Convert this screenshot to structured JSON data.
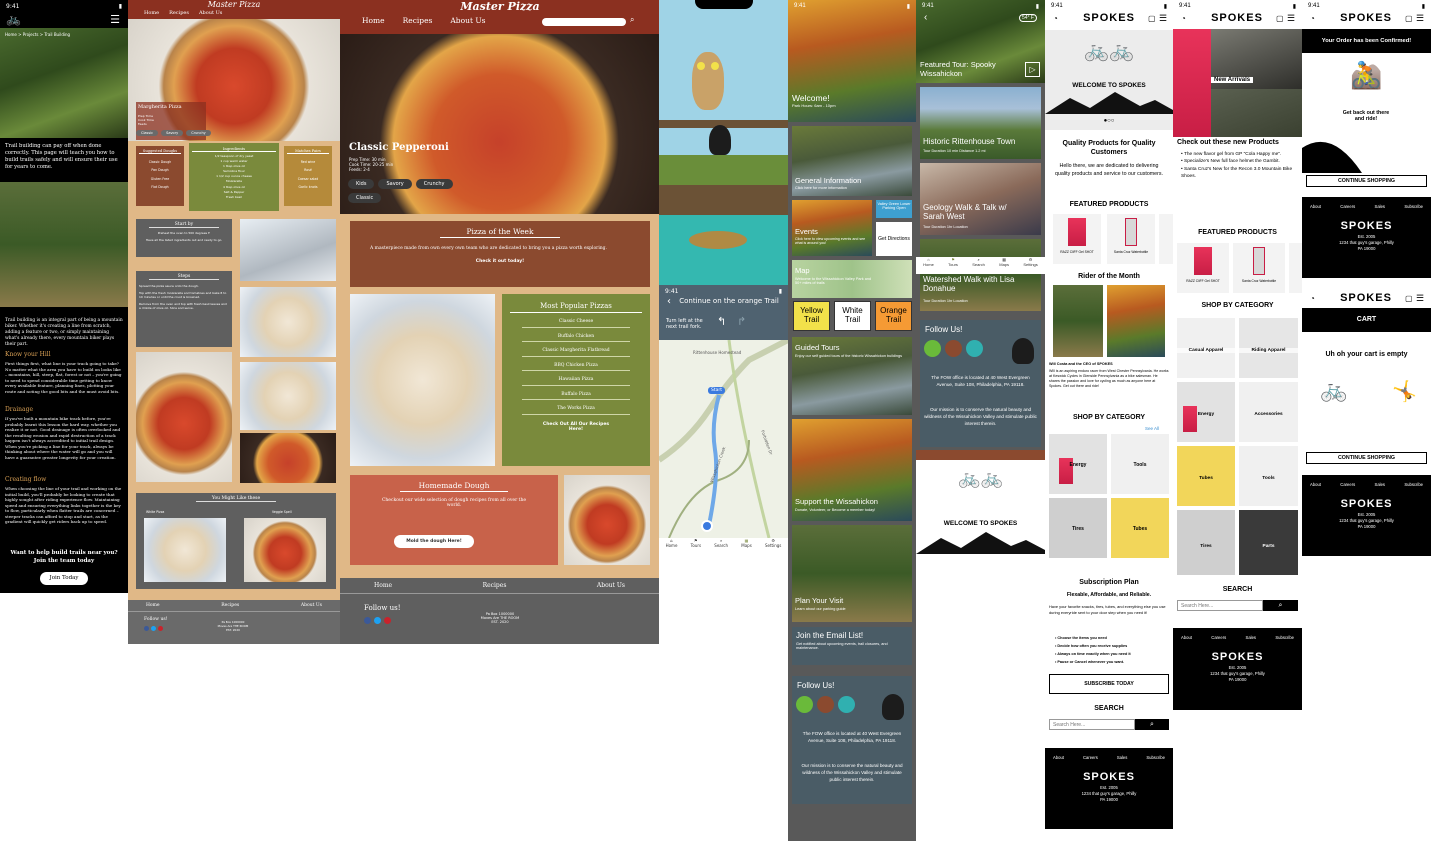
{
  "trail": {
    "status_time": "9:41",
    "breadcrumb": "Home > Projects > Trail Building",
    "p1": "Trail building can pay off when done correctly. This page will teach you how to build trails safely and will ensure their use for years to come.",
    "p2": "Trail building is an integral part of being a mountain biker. Whether it's creating a line from scratch, adding a feature or two, or simply maintaining what's already there, every mountain biker plays their part.",
    "h1": "Know your Hill",
    "p3": "First things first, what line is your track going to take? No matter what the area you have to build on looks like – mountains, hill, steep, flat, forest or not – you're going to need to spend considerable time getting to know every available feature, planning lines, plotting your route and noting the good bits and the must avoid bits.",
    "h2": "Drainage",
    "p4": "If you've built a mountain bike track before, you're probably learnt this lesson the hard way, whether you realize it or not. Good drainage is often overlooked and the resulting erosion and rapid destruction of a track happen isn't always accredited to initial trail design. When you're picking a line for your track, always be thinking about where the water will go and you will have a guarantee greater longevity for your creation.",
    "h3": "Creating flow",
    "p5": "When choosing the line of your trail and working on the initial build, you'll probably be looking to create that highly sought after riding experience flow. Maintaining speed and ensuring everything links together is the key to flow, particularly when flatter trails are concerned – steeper tracks can afford to stop and start, as the gradient will quickly get riders back up to speed.",
    "cta": "Want to help build trails near you? Join the team today",
    "btn": "Join Today"
  },
  "pizza_small": {
    "title": "Master Pizza",
    "nav": [
      "Home",
      "Recipes",
      "About Us"
    ],
    "hero": "Margherita Pizza",
    "hero_meta": "Prep Time\nCook Time\nFeeds",
    "tags": [
      "Classic",
      "Savory",
      "Crunchy"
    ],
    "cols": [
      {
        "title": "Suggested Doughs",
        "items": [
          "Classic Dough",
          "Pan Dough",
          "Gluten Free",
          "Flat Dough"
        ]
      },
      {
        "title": "Ingredients",
        "items": [
          "1/2 teaspoon of dry yeast",
          "1 cup warm water",
          "1 tbsp olive oil",
          "Semolina flour",
          "1 1/2 cup ounce cheese",
          "Mozzarella",
          "4 tbsp olive oil",
          "Salt & Pepper",
          "Fresh basil"
        ]
      },
      {
        "title": "Matches Pairs",
        "items": [
          "Red wine",
          "Rosé",
          "Caesar salad",
          "Garlic knots"
        ]
      }
    ],
    "start_title": "Start by",
    "start_body": "Preheat the oven to 500 degrees F.",
    "start_body2": "Have all the listed ingredients out and ready to go.",
    "steps_title": "Steps",
    "steps": [
      "Spread the pizza sauce onto the dough.",
      "Top with the fresh mozzarella and tomatoes and bake 8 to 10 minutes or until the crust is browned.",
      "Remove from the oven and top with fresh basil leaves and a drizzle of olive oil. Slice and serve."
    ],
    "also_title": "You Might Like these",
    "also": [
      "White Pizza",
      "Veggie Spell"
    ],
    "footer_nav": [
      "Home",
      "Recipes",
      "About Us"
    ],
    "follow": "Follow us!",
    "address": "Pa Box 1000000\nMoves Are THE ROOM\nEST. 2020"
  },
  "pizza_big": {
    "title": "Master Pizza",
    "nav": [
      "Home",
      "Recipes",
      "About Us"
    ],
    "hero": "Classic Pepperoni",
    "hero_meta": [
      "Prep Time: 30 min",
      "Cook Time: 20-25 min",
      "Feeds: 2-4"
    ],
    "tags": [
      "Kids",
      "Savory",
      "Crunchy",
      "Classic"
    ],
    "week_title": "Pizza of the Week",
    "week_body": "A masterpiece made from own every own team who are dedicated to bring you a pizza worth exploring.",
    "week_link": "Check it out today!",
    "popular_title": "Most Popular Pizzas",
    "popular": [
      "Classic Cheese",
      "Buffalo Chicken",
      "Classic Margherita Flatbread",
      "BBQ Chicken Pizza",
      "Hawaiian Pizza",
      "Buffalo Pizza",
      "The Works Pizza"
    ],
    "popular_link": "Check Out All Our Recipes Here!",
    "dough_title": "Homemade Dough",
    "dough_body": "Checkout our wide selection of dough recipes from all over the world.",
    "dough_btn": "Mold the dough Here!",
    "footer_nav": [
      "Home",
      "Recipes",
      "About Us"
    ],
    "follow": "Follow us!",
    "address": "Pa Box 1000000\nMoves Are THE ROOM\nEST. 2020"
  },
  "map": {
    "status_time": "9:41",
    "direction": "Continue on the orange Trail",
    "turn": "Turn left at the next trail fork.",
    "start": "Start",
    "place": "Rittenhouse Homestead",
    "road1": "Forbidden Dr",
    "road2": "Wissahickon Creek",
    "tabs": [
      "Home",
      "Tours",
      "Search",
      "Maps",
      "Settings"
    ]
  },
  "fow": {
    "status_time": "9:41",
    "welcome": "Welcome!",
    "hours": "Park Hours: 6am - 10pm",
    "general": "General Information",
    "general_sub": "Click here for more information",
    "valley": "Valley Green Lower Parking Open",
    "directions": "Get Directions",
    "events": "Events",
    "events_sub": "Click here to view upcoming events and see what is around you!",
    "map_t": "Map",
    "map_sub": "Welcome to the Wissahickon Valley Park and 50+ miles of trails",
    "trail_btns": [
      "Yellow Trail",
      "White Trail",
      "Orange Trail"
    ],
    "tours": "Guided Tours",
    "tours_sub": "Enjoy our self guided tours of the historic Wissahickon buildings",
    "support": "Support the Wissahickon",
    "support_sub": "Donate, Volunteer, or Become a member today!",
    "plan": "Plan Your Visit",
    "plan_sub": "Learn about our parking guide",
    "email": "Join the Email List!",
    "email_sub": "Get notified about upcoming events, trail closures, and maintenance.",
    "follow": "Follow Us!",
    "address": "The FOW office is located at 40 West Evergreen Avenue, Suite 108, Philadelphia, PA 19118.",
    "mission": "Our mission is to conserve the natural beauty and wildness of the Wissahickon Valley and stimulate public interest therein."
  },
  "tour": {
    "status_time": "9:41",
    "featured": "Featured Tour: Spooky Wissahickon",
    "temp": "54° F",
    "c1": "Historic Rittenhouse Town",
    "c1s": "Tour Duration 10 min Distance 1.2 mi",
    "c2": "Geology Walk & Talk w/ Sarah West",
    "c2s": "Tour Duration 1hr Location",
    "c3": "Watershed Walk with Lisa Donahue",
    "c3s": "Tour Duration 1hr Location",
    "tabs": [
      "Home",
      "Tours",
      "Search",
      "Maps",
      "Settings"
    ],
    "follow": "Follow Us!",
    "address": "The FOW office is located at 40 West Evergreen Avenue, Suite 108, Philadelphia, PA 19118.",
    "mission": "Our mission is to conserve the natural beauty and wildness of the Wissahickon Valley and stimulate public interest therein.",
    "welcome": "WELCOME TO SPOKES"
  },
  "spokes1": {
    "status_time": "9:41",
    "brand": "SPOKES",
    "welcome": "WELCOME TO SPOKES",
    "quality": "Quality Products for Quality Customers",
    "quality_body": "Hello there, we are dedicated to delivering quality products and service to our customers.",
    "featured": "FEATURED PRODUCTS",
    "products": [
      "RAZZ CliFF Gel SHOT",
      "Santa Cruz Waterbottle"
    ],
    "rider": "Rider of the Month",
    "rider_name": "Will Costa and the CEO of SPOKES",
    "rider_body": "Will is an aspiring enduro racer from West Chester Pennsylvania. He works at Keswick Cycles in Glenside Pennsylvania as a bike salesman. He shares the passion and love for cycling as much as anyone here at Spokes. Get out there and ride!",
    "shop": "SHOP BY CATEGORY",
    "see_all": "See All",
    "cats": [
      "Energy",
      "Tools",
      "Tires",
      "Tubes"
    ],
    "sub": "Subscription Plan",
    "sub_tag": "Flexable, Affordable, and Reliable.",
    "sub_body": "Have your favorite snacks, tires, tubes, and everything else you use during everyride sent to your door step when you need it!",
    "bullets": [
      "Choose the items you need",
      "Decide how often you receive supplies",
      "Always on time exactly when you need it",
      "Pause or Cancel whenever you want."
    ],
    "sub_btn": "SUBSCRIBE TODAY",
    "search": "SEARCH",
    "search_ph": "Search Here...",
    "foot_nav": [
      "About",
      "Careers",
      "Sales",
      "Subscribe"
    ],
    "est": "Est. 2005",
    "addr": "1234 that guy's garage, Philly PA 19000"
  },
  "spokes2": {
    "status_time": "9:41",
    "brand": "SPOKES",
    "new": "New Arrivals",
    "check": "Check out these new Products",
    "bullets": [
      "The new flavor gel from GP \"Cola Happy me\".",
      "Specialize's New full face helmet the Gambit.",
      "Santa Cruz's New for the Recon 3.0 Mountain Bike Shoes."
    ],
    "featured": "FEATURED PRODUCTS",
    "products": [
      "RAZZ CliFF Gel SHOT",
      "Santa Cruz Waterbottle"
    ],
    "shop": "SHOP BY CATEGORY",
    "cats": [
      "Casual Apparel",
      "Riding Apparel",
      "Energy",
      "Accessories",
      "Tubes",
      "Tools",
      "Tires",
      "Parts"
    ],
    "search": "SEARCH",
    "search_ph": "Search Here...",
    "foot_nav": [
      "About",
      "Careers",
      "Sales",
      "Subscribe"
    ],
    "est": "Est. 2005",
    "addr": "1234 that guy's garage, Philly PA 19000"
  },
  "spokes3": {
    "status_time": "9:41",
    "brand": "SPOKES",
    "confirmed": "Your Order has been Confirmed!",
    "getback": "Get back out there and ride!",
    "continue": "CONTINUE SHOPPING",
    "cart": "CART",
    "empty": "Uh oh your cart is empty",
    "continue2": "CONTINUE SHOPPING",
    "foot_nav": [
      "About",
      "Careers",
      "Sales",
      "Subscribe"
    ],
    "est": "Est. 2005",
    "addr": "1234 that guy's garage, Philly PA 19000"
  },
  "colors": {
    "brick": "#8b4a2f",
    "green": "#7a8a3c",
    "gray": "#5f5f5f",
    "tan": "#e0b887",
    "slate": "#4a5c66",
    "teal": "#30b0b0"
  }
}
